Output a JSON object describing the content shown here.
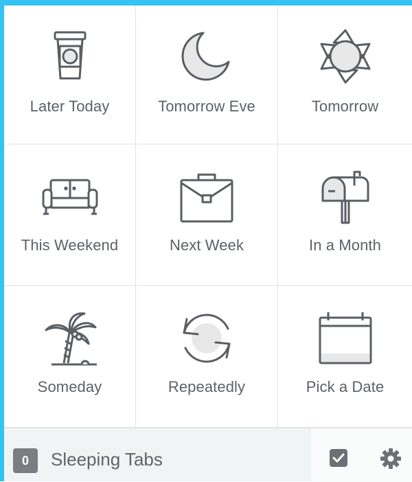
{
  "options": [
    {
      "label": "Later Today",
      "icon": "coffee-cup-icon"
    },
    {
      "label": "Tomorrow Eve",
      "icon": "moon-icon"
    },
    {
      "label": "Tomorrow",
      "icon": "sun-icon"
    },
    {
      "label": "This Weekend",
      "icon": "sofa-icon"
    },
    {
      "label": "Next Week",
      "icon": "briefcase-icon"
    },
    {
      "label": "In a Month",
      "icon": "mailbox-icon"
    },
    {
      "label": "Someday",
      "icon": "palm-tree-icon"
    },
    {
      "label": "Repeatedly",
      "icon": "repeat-icon"
    },
    {
      "label": "Pick a Date",
      "icon": "calendar-icon"
    }
  ],
  "footer": {
    "sleeping_count": "0",
    "sleeping_label": "Sleeping Tabs",
    "check_icon": "checkbox-icon",
    "settings_icon": "gear-icon"
  },
  "colors": {
    "accent_border": "#35c3f1",
    "icon_stroke": "#5a5e63",
    "icon_fill": "#e8e8e8",
    "label_text": "#5d6166",
    "footer_bg": "#f1f4f5"
  }
}
